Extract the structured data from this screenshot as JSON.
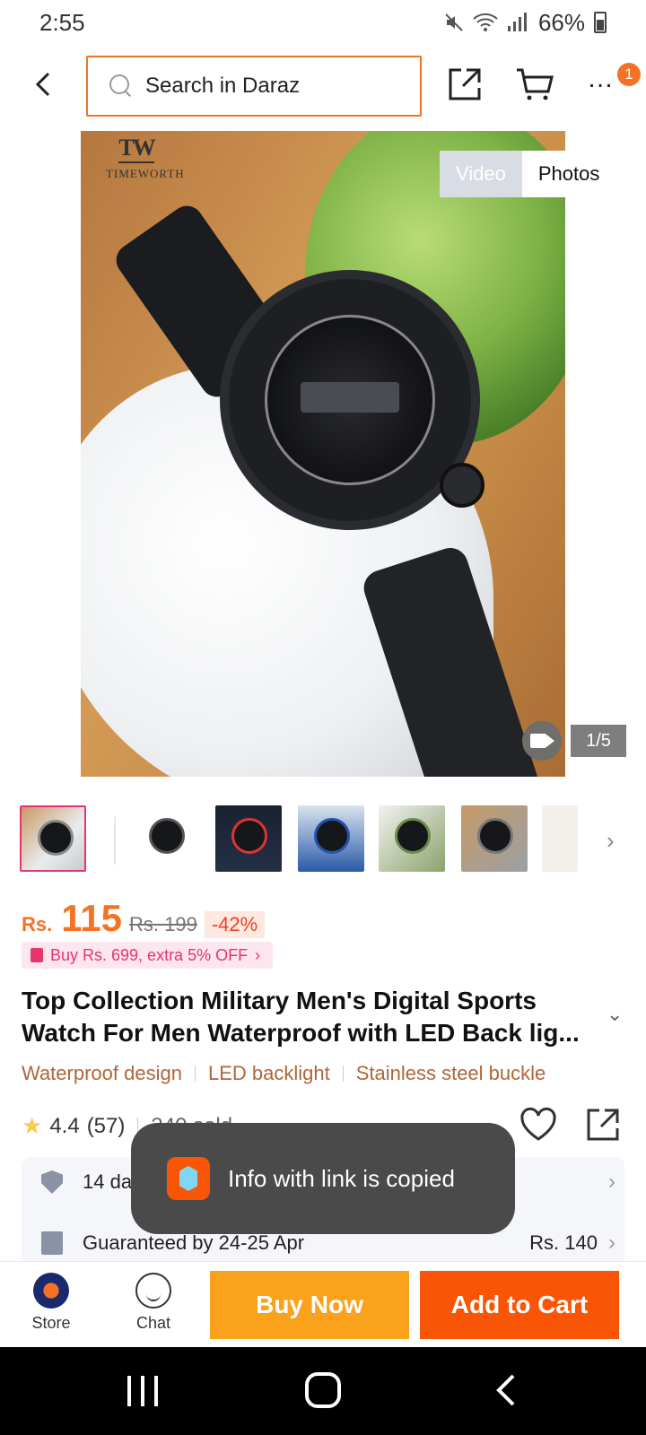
{
  "status_bar": {
    "time": "2:55",
    "battery": "66%"
  },
  "top_nav": {
    "search_placeholder": "Search in Daraz",
    "more_badge": "1"
  },
  "hero": {
    "brand": "TIMEWORTH",
    "brand_mark": "TW",
    "media_tabs": [
      {
        "label": "Video",
        "active": true
      },
      {
        "label": "Photos",
        "active": false
      }
    ],
    "counter": "1/5"
  },
  "thumbnails": {
    "count": 7,
    "selected_index": 0
  },
  "price": {
    "currency": "Rs.",
    "current": "115",
    "original": "Rs. 199",
    "discount": "-42%"
  },
  "promo": {
    "label": "Buy Rs. 699, extra 5% OFF"
  },
  "product": {
    "title": "Top Collection Military Men's Digital Sports Watch For Men Waterproof with LED Back lig...",
    "features": [
      "Waterproof design",
      "LED backlight",
      "Stainless steel buckle"
    ],
    "rating": "4.4",
    "rating_count": "(57)",
    "sold": "340 sold"
  },
  "info": {
    "return_label": "14 days easy return",
    "delivery_label": "Guaranteed by 24-25 Apr",
    "delivery_fee": "Rs. 140"
  },
  "toast": {
    "message": "Info with link is copied"
  },
  "bottom_bar": {
    "store_label": "Store",
    "chat_label": "Chat",
    "buy_now_label": "Buy Now",
    "add_to_cart_label": "Add to Cart"
  },
  "colors": {
    "accent": "#f57224",
    "buy_now": "#faa21b",
    "add_to_cart": "#f85606",
    "promo": "#e8336d",
    "feature_text": "#b0653b"
  }
}
